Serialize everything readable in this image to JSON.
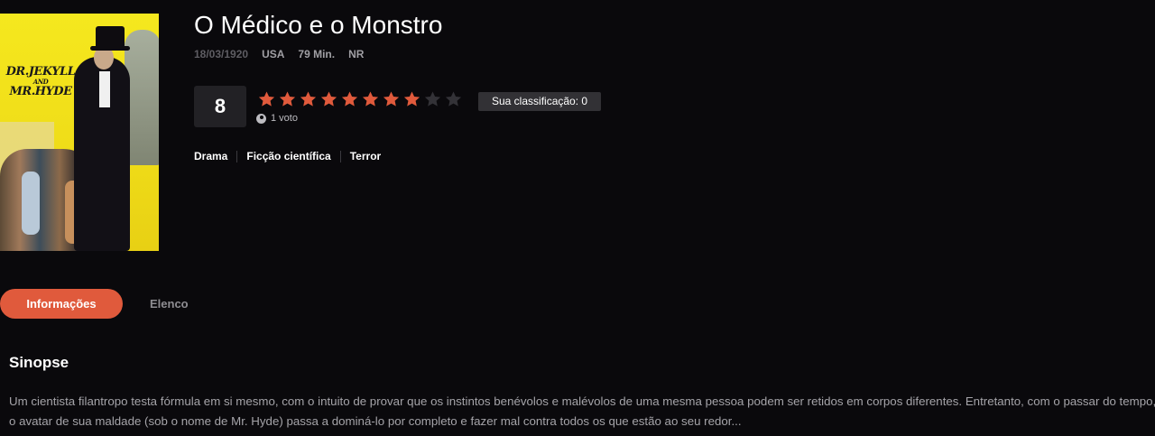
{
  "movie": {
    "title": "O Médico e o Monstro",
    "release_date": "18/03/1920",
    "country": "USA",
    "duration": "79 Min.",
    "rating_code": "NR",
    "poster": {
      "title_line1": "DR.JEKYLL",
      "title_and": "AND",
      "title_line2": "MR.HYDE"
    }
  },
  "rating": {
    "score": "8",
    "stars_total": 10,
    "stars_filled": 8,
    "votes": "1 voto",
    "my_rating_label": "Sua classificação: 0",
    "star_color": "#e05a3c",
    "star_empty_color": "#333237"
  },
  "genres": [
    "Drama",
    "Ficção científica",
    "Terror"
  ],
  "tabs": {
    "info": "Informações",
    "cast": "Elenco"
  },
  "synopsis": {
    "heading": "Sinopse",
    "text": "Um cientista filantropo testa fórmula em si mesmo, com o intuito de provar que os instintos benévolos e malévolos de uma mesma pessoa podem ser retidos em corpos diferentes. Entretanto, com o passar do tempo, o avatar de sua maldade (sob o nome de Mr. Hyde) passa a dominá-lo por completo e fazer mal contra todos os que estão ao seu redor..."
  },
  "colors": {
    "accent": "#e05a3c",
    "background": "#0a090c"
  }
}
